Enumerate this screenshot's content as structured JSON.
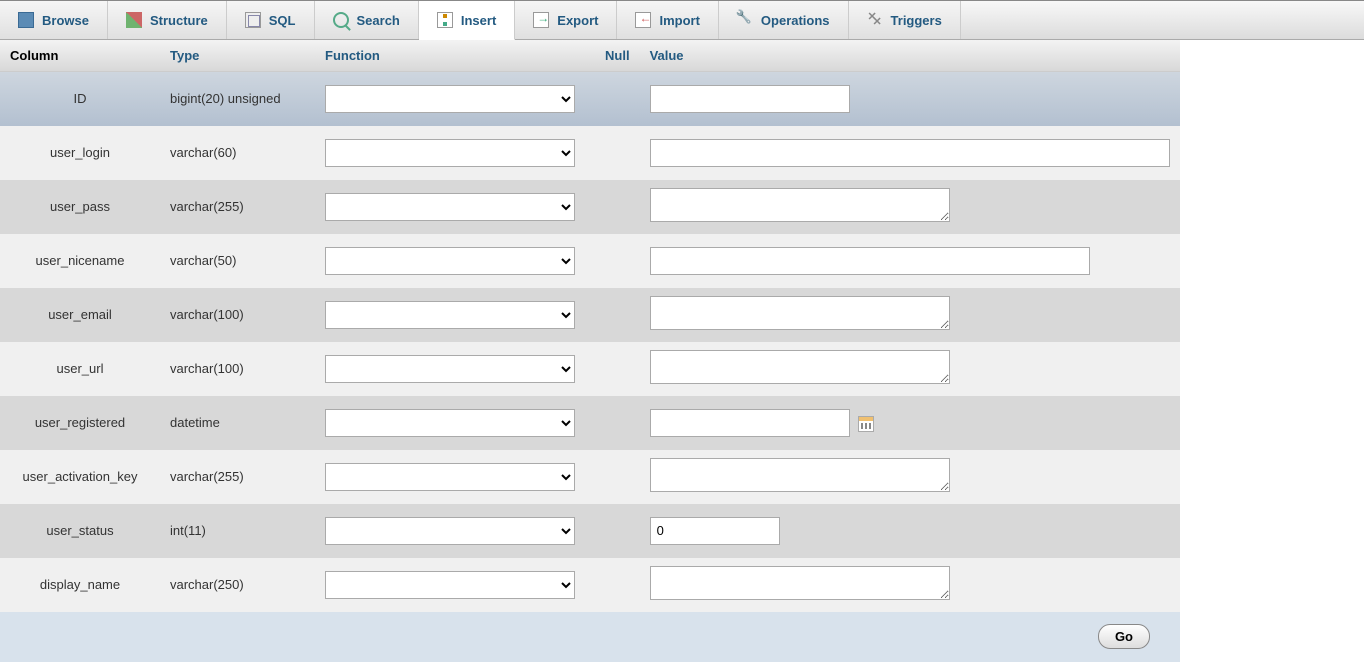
{
  "tabs": [
    {
      "label": "Browse",
      "icon": "browse-icon"
    },
    {
      "label": "Structure",
      "icon": "structure-icon"
    },
    {
      "label": "SQL",
      "icon": "sql-icon"
    },
    {
      "label": "Search",
      "icon": "search-icon"
    },
    {
      "label": "Insert",
      "icon": "insert-icon",
      "active": true
    },
    {
      "label": "Export",
      "icon": "export-icon"
    },
    {
      "label": "Import",
      "icon": "import-icon"
    },
    {
      "label": "Operations",
      "icon": "operations-icon"
    },
    {
      "label": "Triggers",
      "icon": "triggers-icon"
    }
  ],
  "headers": {
    "column": "Column",
    "type": "Type",
    "function": "Function",
    "null": "Null",
    "value": "Value"
  },
  "rows": [
    {
      "column": "ID",
      "type": "bigint(20) unsigned",
      "value": "",
      "input": "short",
      "highlight": true
    },
    {
      "column": "user_login",
      "type": "varchar(60)",
      "value": "",
      "input": "wide"
    },
    {
      "column": "user_pass",
      "type": "varchar(255)",
      "value": "",
      "input": "textarea"
    },
    {
      "column": "user_nicename",
      "type": "varchar(50)",
      "value": "",
      "input": "med"
    },
    {
      "column": "user_email",
      "type": "varchar(100)",
      "value": "",
      "input": "textarea"
    },
    {
      "column": "user_url",
      "type": "varchar(100)",
      "value": "",
      "input": "textarea"
    },
    {
      "column": "user_registered",
      "type": "datetime",
      "value": "",
      "input": "short",
      "calendar": true
    },
    {
      "column": "user_activation_key",
      "type": "varchar(255)",
      "value": "",
      "input": "textarea"
    },
    {
      "column": "user_status",
      "type": "int(11)",
      "value": "0",
      "input": "num"
    },
    {
      "column": "display_name",
      "type": "varchar(250)",
      "value": "",
      "input": "textarea"
    }
  ],
  "footer": {
    "go": "Go"
  }
}
